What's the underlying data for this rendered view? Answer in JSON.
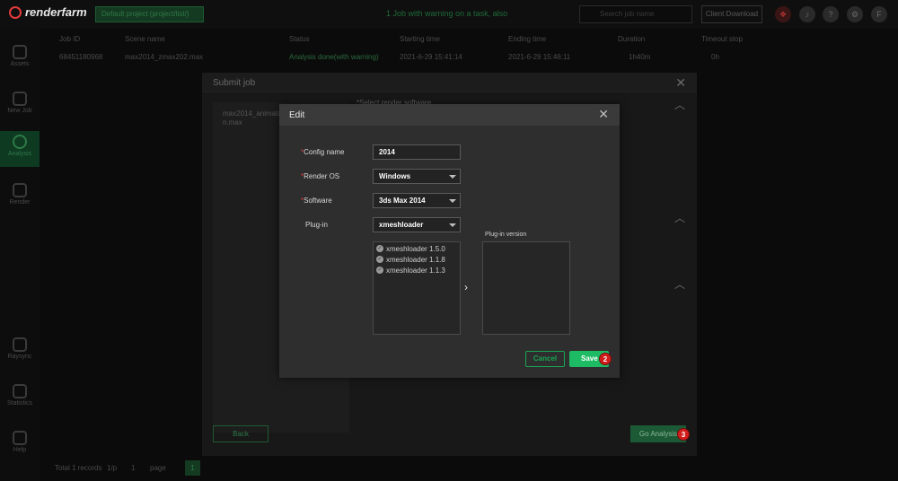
{
  "topbar": {
    "brand": "renderfarm",
    "project_select": "Default project (project/list/)",
    "notice": "1 Job with warning on a task, also",
    "search_placeholder": "Search job name",
    "client_download": "Client Download",
    "icons": [
      "gift-icon",
      "bell-icon",
      "help-icon",
      "settings-icon",
      "user-icon"
    ],
    "user_initial": "F"
  },
  "sidebar": {
    "items": [
      {
        "label": "Assets",
        "icon": "assets-icon"
      },
      {
        "label": "New Job",
        "icon": "new-job-icon"
      },
      {
        "label": "Analysis",
        "icon": "analysis-icon",
        "active": true
      },
      {
        "label": "Render",
        "icon": "render-icon"
      },
      {
        "label": "Raysync",
        "icon": "raysync-icon"
      },
      {
        "label": "Statistics",
        "icon": "statistics-icon"
      },
      {
        "label": "Help",
        "icon": "help-icon"
      }
    ]
  },
  "job_table": {
    "columns": [
      "Job ID",
      "Scene name",
      "Status",
      "Starting time",
      "Ending time",
      "Duration",
      "Timeout stop"
    ],
    "row": {
      "job_id": "68451180968",
      "scene_name": "max2014_zmax202.max",
      "status": "Analysis done(with warning)",
      "starting_time": "2021-6-29 15:41:14",
      "ending_time": "2021-6-29 15:46:11",
      "duration": "1h40m",
      "timeout_stop": "0h"
    },
    "pager": {
      "total": "Total 1 records",
      "per_page": "1/p",
      "page_input": "1",
      "page_label": "page",
      "current_page": "1"
    }
  },
  "submit_modal": {
    "title": "Submit job",
    "file_name": "max2014_animation.max",
    "section_label": "*Select render software",
    "back_label": "Back",
    "go_label": "Go Analysis",
    "go_step": "3"
  },
  "edit_modal": {
    "title": "Edit",
    "fields": {
      "config_name": {
        "label": "Config name",
        "required": true,
        "value": "2014"
      },
      "render_os": {
        "label": "Render OS",
        "required": true,
        "value": "Windows"
      },
      "software": {
        "label": "Software",
        "required": true,
        "value": "3ds Max 2014"
      },
      "plugin": {
        "label": "Plug-in",
        "required": false,
        "value": "xmeshloader"
      }
    },
    "plugin_items": [
      "xmeshloader 1.5.0",
      "xmeshloader 1.1.8",
      "xmeshloader 1.1.3"
    ],
    "plugin_version_label": "Plug-in version",
    "cancel_label": "Cancel",
    "save_label": "Save",
    "save_step": "2"
  },
  "colors": {
    "accent": "#1dbb63",
    "brand_red": "#e23b3b",
    "badge_red": "#d21d1d"
  }
}
